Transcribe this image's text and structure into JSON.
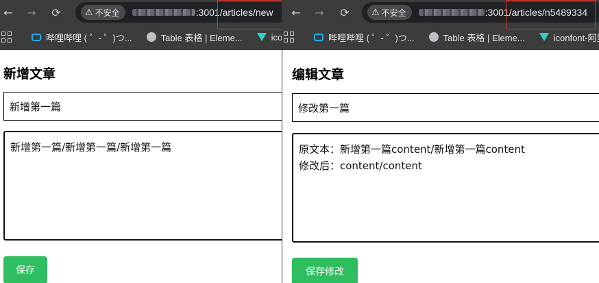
{
  "left": {
    "nav": {
      "back": "←",
      "forward": "→",
      "reload": "⟳"
    },
    "security_label": "不安全",
    "url_visible": ":3001/articles/new",
    "bookmarks": [
      "哔哩哔哩 ( ゜- ゜)つ...",
      "Table 表格 | Eleme...",
      "iconfc"
    ],
    "page_title": "新增文章",
    "title_input_value": "新增第一篇",
    "content_lines": [
      "新增第一篇/新增第一篇/新增第一篇"
    ],
    "submit_label": "保存"
  },
  "right": {
    "nav": {
      "back": "←",
      "forward": "→",
      "reload": "⟳"
    },
    "security_label": "不安全",
    "url_visible": ":3001/articles/n5489334",
    "bookmarks": [
      "哔哩哔哩 ( ゜- ゜)つ...",
      "Table 表格 | Eleme...",
      "iconfont-阿里"
    ],
    "page_title": "编辑文章",
    "title_input_value": "修改第一篇",
    "content_lines": [
      "原文本：新增第一篇content/新增第一篇content",
      "修改后：content/content"
    ],
    "submit_label": "保存修改"
  },
  "colors": {
    "browser_chrome": "#3c3c3c",
    "omnibox": "#202124",
    "url_highlight_box": "#d93025",
    "button_green": "#2ebd5f"
  }
}
